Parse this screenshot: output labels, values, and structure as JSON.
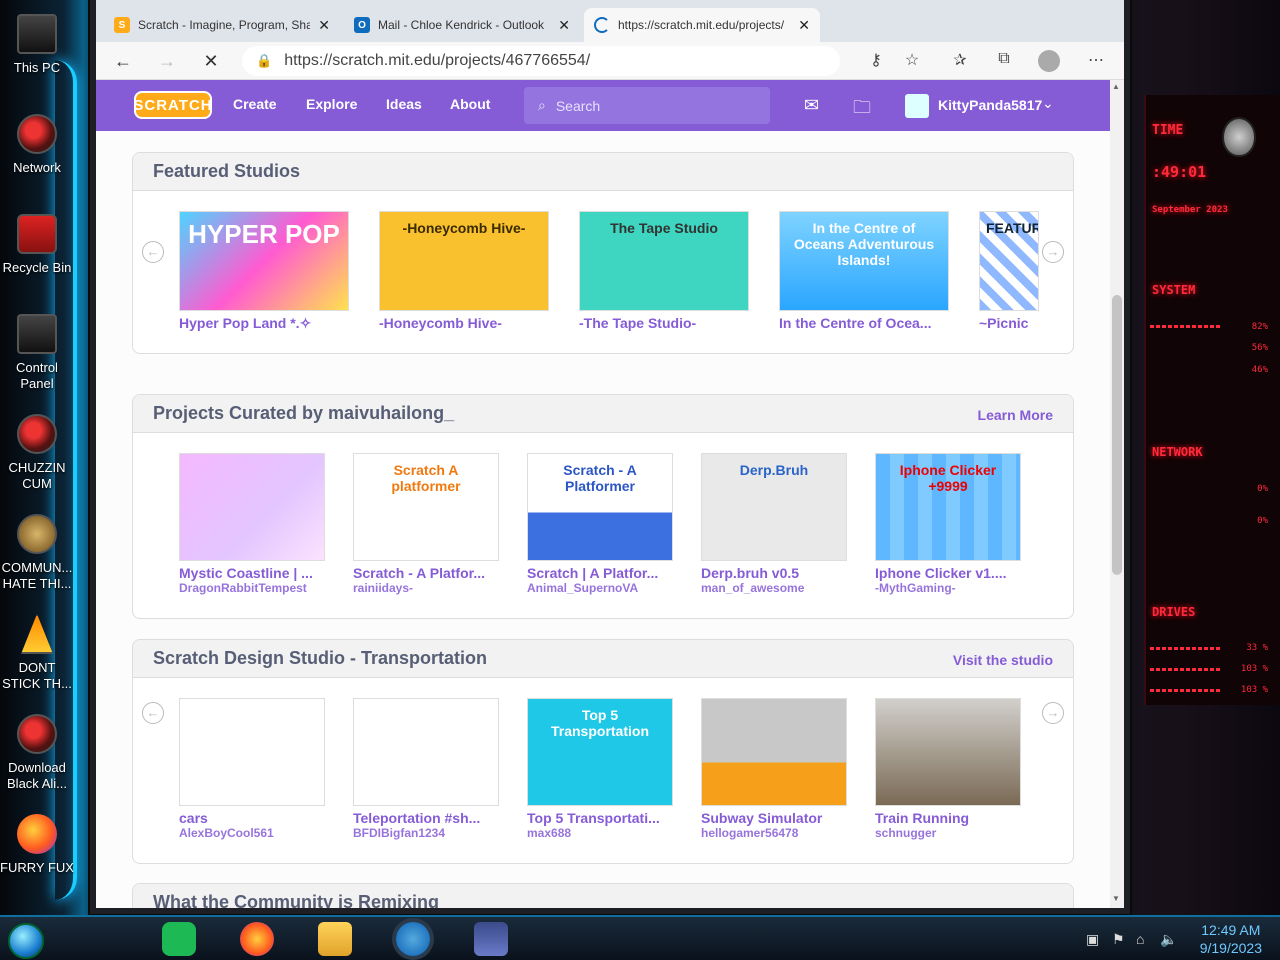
{
  "desktop": {
    "icons": [
      {
        "label": "This PC",
        "cls": "pc"
      },
      {
        "label": "Network",
        "cls": ""
      },
      {
        "label": "Recycle Bin",
        "cls": "bin"
      },
      {
        "label": "Control Panel",
        "cls": "pc"
      },
      {
        "label": "CHUZZIN CUM",
        "cls": ""
      },
      {
        "label": "COMMUN... HATE THI...",
        "cls": "bag"
      },
      {
        "label": "DONT STICK TH...",
        "cls": "cone"
      },
      {
        "label": "Download Black Ali...",
        "cls": ""
      },
      {
        "label": "FURRY FUX",
        "cls": "ff"
      }
    ]
  },
  "rainmeter": {
    "time_label": "TIME",
    "time": ":49:01",
    "date": "September 2023",
    "system_label": "SYSTEM",
    "network_label": "NETWORK",
    "drives_label": "DRIVES",
    "cpu": [
      "82%",
      "56%",
      "46%"
    ],
    "net": [
      "0%",
      "0%"
    ],
    "drives": [
      "33 %",
      "103 %",
      "103 %"
    ]
  },
  "browser": {
    "tabs": [
      {
        "title": "Scratch - Imagine, Program, Sha",
        "icon": "S",
        "color": "#ffab19"
      },
      {
        "title": "Mail - Chloe Kendrick - Outlook",
        "icon": "O",
        "color": "#0f6cbd"
      },
      {
        "title": "https://scratch.mit.edu/projects/",
        "icon": "",
        "color": "#ffffff"
      }
    ],
    "url": "https://scratch.mit.edu/projects/467766554/"
  },
  "scratch": {
    "logo": "SCRATCH",
    "nav": [
      "Create",
      "Explore",
      "Ideas",
      "About"
    ],
    "search_placeholder": "Search",
    "username": "KittyPanda5817",
    "sections": [
      {
        "title": "Featured Studios",
        "link": "",
        "items": [
          {
            "name": "Hyper Pop Land *.✧",
            "author": "",
            "thumb_text": "HYPER POP",
            "bg": "linear-gradient(135deg,#4fd3ff,#ff5bd1 50%,#ffe14f)",
            "fg": "#fff"
          },
          {
            "name": "-Honeycomb Hive-",
            "author": "",
            "thumb_text": "-Honeycomb Hive-",
            "bg": "#f9c12e",
            "fg": "#3a2a00"
          },
          {
            "name": "-The Tape Studio-",
            "author": "",
            "thumb_text": "The Tape Studio",
            "bg": "#3ed6c0",
            "fg": "#333"
          },
          {
            "name": "In the Centre of Ocea...",
            "author": "",
            "thumb_text": "In the Centre of Oceans Adventurous Islands!",
            "bg": "linear-gradient(#7fd3ff,#2aa6ff)",
            "fg": "#fff"
          },
          {
            "name": "~Picnic",
            "author": "",
            "thumb_text": "FEATURED!",
            "bg": "repeating-linear-gradient(45deg,#8fb8ff 0 8px,#fff 8px 16px)",
            "fg": "#123"
          }
        ]
      },
      {
        "title": "Projects Curated by maivuhailong_",
        "link": "Learn More",
        "items": [
          {
            "name": "Mystic Coastline | ...",
            "author": "DragonRabbitTempest",
            "thumb_text": "",
            "bg": "linear-gradient(135deg,#f4b8ff,#e3c6ff 60%,#fbe3ff)",
            "fg": "#fff"
          },
          {
            "name": "Scratch - A Platfor...",
            "author": "rainiidays-",
            "thumb_text": "Scratch A platformer",
            "bg": "#ffffff",
            "fg": "#f07a10"
          },
          {
            "name": "Scratch | A Platfor...",
            "author": "Animal_SupernoVA",
            "thumb_text": "Scratch - A Platformer",
            "bg": "linear-gradient(#ffffff 55%,#3c6fe0 55%)",
            "fg": "#2b56c5"
          },
          {
            "name": "Derp.bruh v0.5",
            "author": "man_of_awesome",
            "thumb_text": "Derp.Bruh",
            "bg": "#e9e9e9",
            "fg": "#2a64c8"
          },
          {
            "name": "Iphone Clicker v1....",
            "author": "-MythGaming-",
            "thumb_text": "Iphone Clicker +9999",
            "bg": "repeating-linear-gradient(90deg,#5fb8ff 0 14px,#7fcaff 14px 28px)",
            "fg": "#e00"
          }
        ]
      },
      {
        "title": "Scratch Design Studio - Transportation",
        "link": "Visit the studio",
        "items": [
          {
            "name": "cars",
            "author": "AlexBoyCool561",
            "thumb_text": "",
            "bg": "#ffffff",
            "fg": "#333"
          },
          {
            "name": "Teleportation #sh...",
            "author": "BFDIBigfan1234",
            "thumb_text": "",
            "bg": "#ffffff",
            "fg": "#333"
          },
          {
            "name": "Top 5 Transportati...",
            "author": "max688",
            "thumb_text": "Top 5 Transportation",
            "bg": "#1ec8e6",
            "fg": "#fff"
          },
          {
            "name": "Subway Simulator",
            "author": "hellogamer56478",
            "thumb_text": "",
            "bg": "linear-gradient(#c8c8c8 60%,#f59f1a 60%)",
            "fg": "#333"
          },
          {
            "name": "Train Running",
            "author": "schnugger",
            "thumb_text": "",
            "bg": "linear-gradient(#d2d0cc,#7a6a55)",
            "fg": "#333"
          }
        ]
      }
    ],
    "next_section": "What the Community is Remixing"
  },
  "taskbar": {
    "time": "12:49 AM",
    "date": "9/19/2023"
  }
}
